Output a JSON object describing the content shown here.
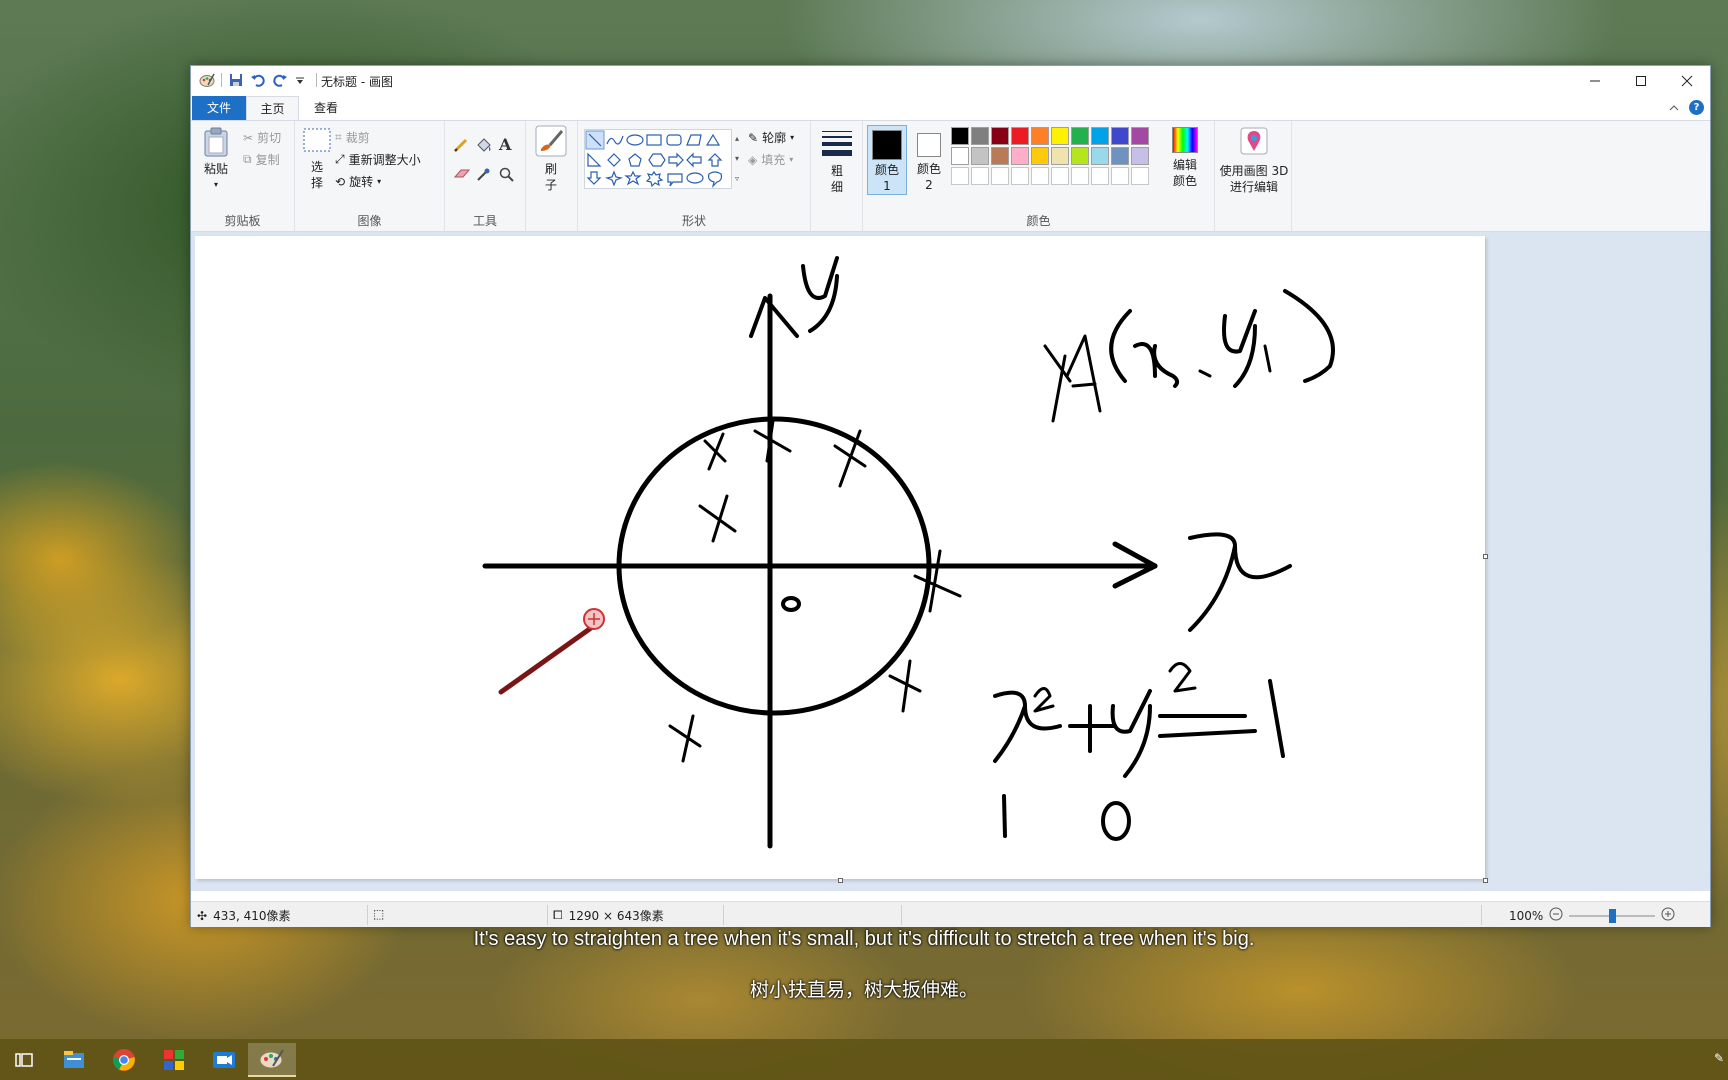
{
  "window": {
    "title": "无标题 - 画图"
  },
  "tabs": [
    {
      "label": "文件"
    },
    {
      "label": "主页"
    },
    {
      "label": "查看"
    }
  ],
  "clipboard": {
    "paste": "粘贴",
    "cut": "剪切",
    "copy": "复制",
    "group": "剪贴板"
  },
  "image": {
    "select": "选择",
    "crop": "裁剪",
    "resize": "重新调整大小",
    "rotate": "旋转",
    "group": "图像"
  },
  "tools": {
    "group": "工具"
  },
  "brushes": {
    "label": "刷子"
  },
  "shapes": {
    "outline": "轮廓",
    "fill": "填充",
    "group": "形状"
  },
  "size": {
    "label": "粗细"
  },
  "colors": {
    "color1": "颜色 1",
    "color2": "颜色 2",
    "edit": "编辑颜色",
    "paint3d": "使用画图 3D 进行编辑",
    "group": "颜色",
    "palette_row1": [
      "#000000",
      "#7f7f7f",
      "#880015",
      "#ed1c24",
      "#ff7f27",
      "#fff200",
      "#22b14c",
      "#00a2e8",
      "#3f48cc",
      "#a349a4"
    ],
    "palette_row2": [
      "#ffffff",
      "#c3c3c3",
      "#b97a57",
      "#ffaec9",
      "#ffc90e",
      "#efe4b0",
      "#b5e61d",
      "#99d9ea",
      "#7092be",
      "#c8bfe7"
    ]
  },
  "statusbar": {
    "cursor": "433, 410像素",
    "image_size": "1290 × 643像素",
    "zoom": "100%"
  },
  "subtitles": {
    "en": "It's easy to straighten a tree when it's small, but it's difficult to stretch a tree when it's big.",
    "zh": "树小扶直易，树大扳伸难。"
  }
}
